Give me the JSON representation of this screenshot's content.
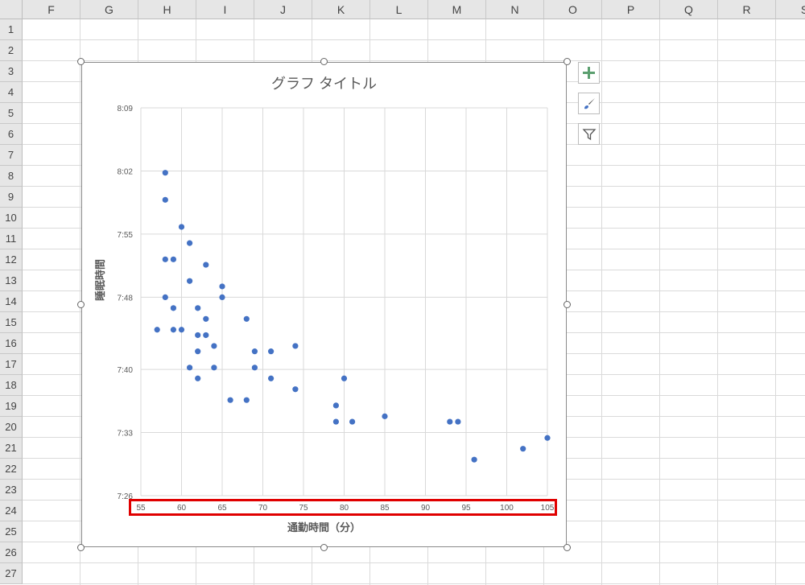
{
  "spreadsheet": {
    "columns": [
      "F",
      "G",
      "H",
      "I",
      "J",
      "K",
      "L",
      "M",
      "N",
      "O",
      "P",
      "Q",
      "R",
      "S"
    ],
    "rows": [
      "1",
      "2",
      "3",
      "4",
      "5",
      "6",
      "7",
      "8",
      "9",
      "10",
      "11",
      "12",
      "13",
      "14",
      "15",
      "16",
      "17",
      "18",
      "19",
      "20",
      "21",
      "22",
      "23",
      "24",
      "25",
      "26",
      "27"
    ]
  },
  "chart_toolbar": {
    "add_element_icon": "plus-icon",
    "style_icon": "brush-icon",
    "filter_icon": "filter-icon",
    "add_color": "#5b9f6f"
  },
  "chart_data": {
    "type": "scatter",
    "title": "グラフ タイトル",
    "xlabel": "通勤時間（分）",
    "ylabel": "睡眠時間",
    "x_ticks": [
      "55",
      "60",
      "65",
      "70",
      "75",
      "80",
      "85",
      "90",
      "95",
      "100",
      "105"
    ],
    "y_ticks": [
      "7:26",
      "7:33",
      "7:40",
      "7:48",
      "7:55",
      "8:02",
      "8:09"
    ],
    "xlim": [
      55,
      105
    ],
    "ylim_minutes": [
      446,
      489
    ],
    "grid": true,
    "marker_color": "#4472c4",
    "highlight_color": "#e00000",
    "points": [
      {
        "x": 58,
        "y": 8.03
      },
      {
        "x": 58,
        "y": 7.98
      },
      {
        "x": 60,
        "y": 7.93
      },
      {
        "x": 61,
        "y": 7.9
      },
      {
        "x": 58,
        "y": 7.87
      },
      {
        "x": 59,
        "y": 7.87
      },
      {
        "x": 63,
        "y": 7.86
      },
      {
        "x": 61,
        "y": 7.83
      },
      {
        "x": 65,
        "y": 7.82
      },
      {
        "x": 58,
        "y": 7.8
      },
      {
        "x": 65,
        "y": 7.8
      },
      {
        "x": 59,
        "y": 7.78
      },
      {
        "x": 62,
        "y": 7.78
      },
      {
        "x": 63,
        "y": 7.76
      },
      {
        "x": 68,
        "y": 7.76
      },
      {
        "x": 57,
        "y": 7.74
      },
      {
        "x": 59,
        "y": 7.74
      },
      {
        "x": 60,
        "y": 7.74
      },
      {
        "x": 62,
        "y": 7.73
      },
      {
        "x": 63,
        "y": 7.73
      },
      {
        "x": 64,
        "y": 7.71
      },
      {
        "x": 74,
        "y": 7.71
      },
      {
        "x": 62,
        "y": 7.7
      },
      {
        "x": 69,
        "y": 7.7
      },
      {
        "x": 71,
        "y": 7.7
      },
      {
        "x": 61,
        "y": 7.67
      },
      {
        "x": 64,
        "y": 7.67
      },
      {
        "x": 69,
        "y": 7.67
      },
      {
        "x": 62,
        "y": 7.65
      },
      {
        "x": 71,
        "y": 7.65
      },
      {
        "x": 80,
        "y": 7.65
      },
      {
        "x": 74,
        "y": 7.63
      },
      {
        "x": 66,
        "y": 7.61
      },
      {
        "x": 68,
        "y": 7.61
      },
      {
        "x": 79,
        "y": 7.6
      },
      {
        "x": 85,
        "y": 7.58
      },
      {
        "x": 79,
        "y": 7.57
      },
      {
        "x": 81,
        "y": 7.57
      },
      {
        "x": 93,
        "y": 7.57
      },
      {
        "x": 94,
        "y": 7.57
      },
      {
        "x": 105,
        "y": 7.54
      },
      {
        "x": 102,
        "y": 7.52
      },
      {
        "x": 96,
        "y": 7.5
      }
    ]
  }
}
